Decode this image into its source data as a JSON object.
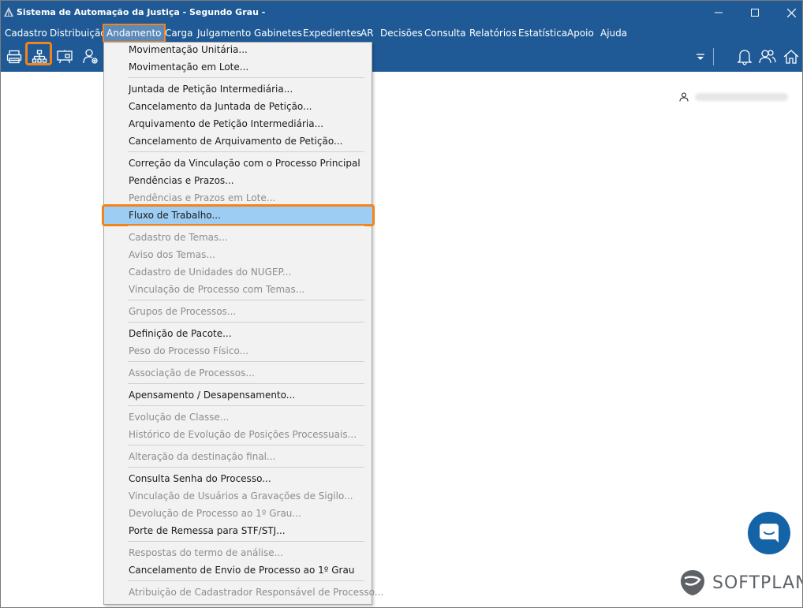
{
  "window": {
    "title": "Sistema de Automação da Justiça - Segundo Grau -",
    "controls": [
      "minimize",
      "maximize",
      "close"
    ]
  },
  "menubar": {
    "items": [
      {
        "label": "Cadastro"
      },
      {
        "label": "Distribuição"
      },
      {
        "label": "Andamento",
        "active": true
      },
      {
        "label": "Carga"
      },
      {
        "label": "Julgamento"
      },
      {
        "label": "Gabinetes"
      },
      {
        "label": "Expedientes"
      },
      {
        "label": "AR"
      },
      {
        "label": "Decisões"
      },
      {
        "label": "Consulta"
      },
      {
        "label": "Relatórios"
      },
      {
        "label": "Estatística"
      },
      {
        "label": "Apoio"
      },
      {
        "label": "Ajuda"
      }
    ]
  },
  "toolbar": {
    "left_icons": [
      "printer-icon",
      "org-chart-icon",
      "board-icon",
      "user-settings-icon"
    ],
    "right_icons": [
      "dropdown-arrow-icon",
      "bell-icon",
      "users-icon",
      "home-icon"
    ]
  },
  "dropdown": {
    "items": [
      {
        "label": "Movimentação Unitária...",
        "enabled": true
      },
      {
        "label": "Movimentação em Lote...",
        "enabled": true
      },
      {
        "separator": true
      },
      {
        "label": "Juntada de Petição Intermediária...",
        "enabled": true
      },
      {
        "label": "Cancelamento da Juntada de Petição...",
        "enabled": true
      },
      {
        "label": "Arquivamento de Petição Intermediária...",
        "enabled": true
      },
      {
        "label": "Cancelamento de Arquivamento de Petição...",
        "enabled": true
      },
      {
        "separator": true
      },
      {
        "label": "Correção da Vinculação com o Processo Principal",
        "enabled": true
      },
      {
        "label": "Pendências e Prazos...",
        "enabled": true
      },
      {
        "label": "Pendências e Prazos em Lote...",
        "enabled": false
      },
      {
        "label": "Fluxo de Trabalho...",
        "enabled": true,
        "highlighted": true
      },
      {
        "separator": true
      },
      {
        "label": "Cadastro de Temas...",
        "enabled": false
      },
      {
        "label": "Aviso dos Temas...",
        "enabled": false
      },
      {
        "label": "Cadastro de Unidades do NUGEP...",
        "enabled": false
      },
      {
        "label": "Vinculação de Processo com Temas...",
        "enabled": false
      },
      {
        "separator": true
      },
      {
        "label": "Grupos de Processos...",
        "enabled": false
      },
      {
        "separator": true
      },
      {
        "label": "Definição de Pacote...",
        "enabled": true
      },
      {
        "label": "Peso do Processo Físico...",
        "enabled": false
      },
      {
        "separator": true
      },
      {
        "label": "Associação de Processos...",
        "enabled": false
      },
      {
        "separator": true
      },
      {
        "label": "Apensamento / Desapensamento...",
        "enabled": true
      },
      {
        "separator": true
      },
      {
        "label": "Evolução de Classe...",
        "enabled": false
      },
      {
        "label": "Histórico de Evolução de Posições Processuais...",
        "enabled": false
      },
      {
        "separator": true
      },
      {
        "label": "Alteração da destinação final...",
        "enabled": false
      },
      {
        "separator": true
      },
      {
        "label": "Consulta Senha do Processo...",
        "enabled": true
      },
      {
        "label": "Vinculação de Usuários a Gravações de Sigilo...",
        "enabled": false
      },
      {
        "label": "Devolução de Processo ao 1º Grau...",
        "enabled": false
      },
      {
        "label": "Porte de Remessa para STF/STJ...",
        "enabled": true
      },
      {
        "separator": true
      },
      {
        "label": "Respostas do termo de análise...",
        "enabled": false
      },
      {
        "label": "Cancelamento de Envio de Processo ao 1º Grau",
        "enabled": true
      },
      {
        "separator": true
      },
      {
        "label": "Atribuição de Cadastrador Responsável de Processo...",
        "enabled": false
      }
    ]
  },
  "brand": {
    "logo_text": "SOFTPLAN"
  },
  "colors": {
    "titlebar": "#1f5a96",
    "highlight_border": "#f2841a",
    "selected_item": "#9dcdf3",
    "chat_button": "#1463a7"
  }
}
